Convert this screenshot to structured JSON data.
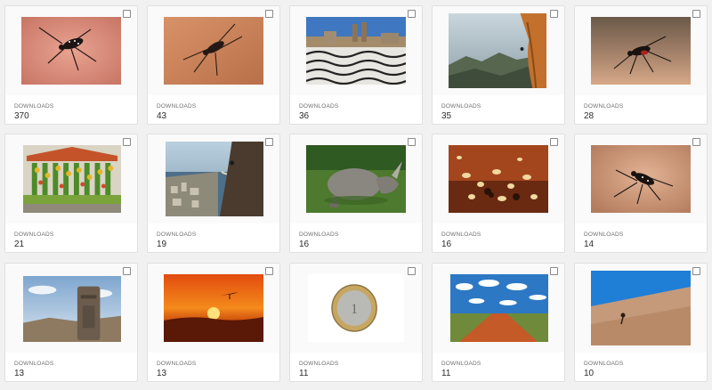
{
  "asset_grid": {
    "stat_label": "DOWNLOADS",
    "items": [
      {
        "subject": "mosquito on skin",
        "downloads": "370"
      },
      {
        "subject": "mosquito on skin",
        "downloads": "43"
      },
      {
        "subject": "wave-pattern plaza with cathedral",
        "downloads": "36"
      },
      {
        "subject": "rock climber on cliff over valley",
        "downloads": "35"
      },
      {
        "subject": "mosquito on skin",
        "downloads": "28"
      },
      {
        "subject": "fruit market stall",
        "downloads": "21"
      },
      {
        "subject": "climber above coastal city",
        "downloads": "19"
      },
      {
        "subject": "white rhinoceros lying on grass",
        "downloads": "16"
      },
      {
        "subject": "termites on soil",
        "downloads": "16"
      },
      {
        "subject": "mosquito on skin",
        "downloads": "14"
      },
      {
        "subject": "stone monolith statue",
        "downloads": "13"
      },
      {
        "subject": "hang glider at sunset",
        "downloads": "13"
      },
      {
        "subject": "coin",
        "downloads": "11"
      },
      {
        "subject": "red dirt road under cloudy sky",
        "downloads": "11"
      },
      {
        "subject": "climber on rock slope",
        "downloads": "10"
      }
    ]
  }
}
